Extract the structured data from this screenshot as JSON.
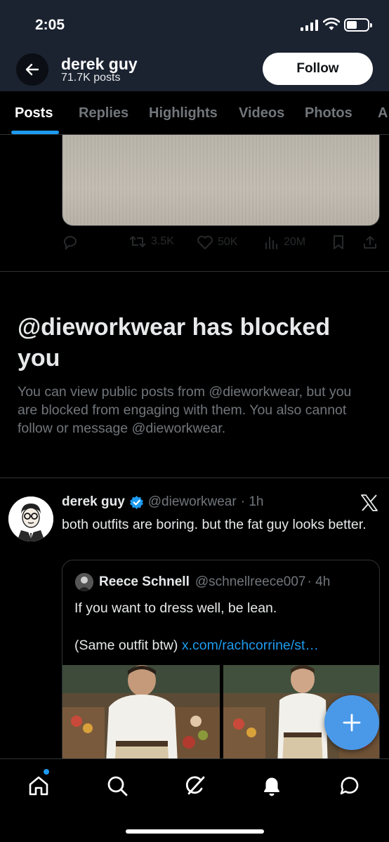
{
  "status_bar": {
    "time": "2:05"
  },
  "header": {
    "name": "derek guy",
    "posts": "71.7K posts",
    "follow_label": "Follow"
  },
  "tabs": [
    "Posts",
    "Replies",
    "Highlights",
    "Videos",
    "Photos",
    "A"
  ],
  "previous_post_actions": {
    "reposts": "3.5K",
    "likes": "50K",
    "views": "20M"
  },
  "blocked": {
    "title": "@dieworkwear has blocked you",
    "message": "You can view public posts from @dieworkwear, but you are blocked from engaging with them. You also cannot follow or message @dieworkwear."
  },
  "tweet": {
    "name": "derek guy",
    "handle": "@dieworkwear",
    "time": "· 1h",
    "text": "both outfits are boring. but the fat guy looks better.",
    "quote": {
      "name": "Reece Schnell",
      "handle": "@schnellreece007",
      "time": "· 4h",
      "line1": "If you want to dress well, be lean.",
      "line2_prefix": "(Same outfit btw)",
      "link": "x.com/rachcorrine/st…"
    }
  },
  "colors": {
    "accent": "#1d9bf0",
    "header_bg": "#1b2230",
    "muted": "#71767b"
  },
  "bottom_nav": [
    "home-icon",
    "search-icon",
    "grok-icon",
    "notifications-icon",
    "messages-icon"
  ]
}
